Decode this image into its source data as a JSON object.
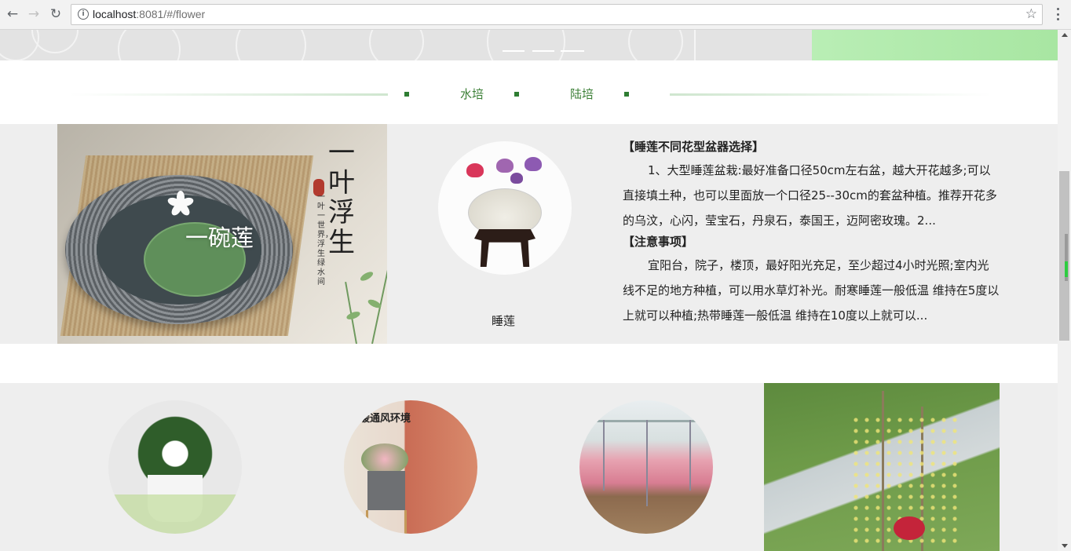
{
  "browser": {
    "url_host": "localhost",
    "url_rest": ":8081/#/flower"
  },
  "tabs": [
    "水培",
    "陆培"
  ],
  "hero": {
    "caption": "一碗莲",
    "vertical_title": "一叶浮生",
    "vertical_sub": "一叶一世界，浮生绿水间"
  },
  "item": {
    "label": "睡莲"
  },
  "description": {
    "heading1": "【睡莲不同花型盆器选择】",
    "para1": "1、大型睡莲盆栽:最好准备口径50cm左右盆，越大开花越多;可以直接填土种，也可以里面放一个口径25--30cm的套盆种植。推荐开花多的乌汶，心闪，莹宝石，丹泉石，泰国王，迈阿密玫瑰。2...",
    "heading2": "【注意事项】",
    "para2": "宜阳台，院子，楼顶，最好阳光充足，至少超过4小时光照;室内光线不足的地方种植，可以用水草灯补光。耐寒睡莲一般低温 维持在5度以上就可以种植;热带睡莲一般低温 维持在10度以上就可以..."
  },
  "gallery": {
    "photo2_text": "暖通风环境"
  },
  "colors": {
    "tab_text": "#3b7f36",
    "panel_bg": "#eeeeee"
  }
}
